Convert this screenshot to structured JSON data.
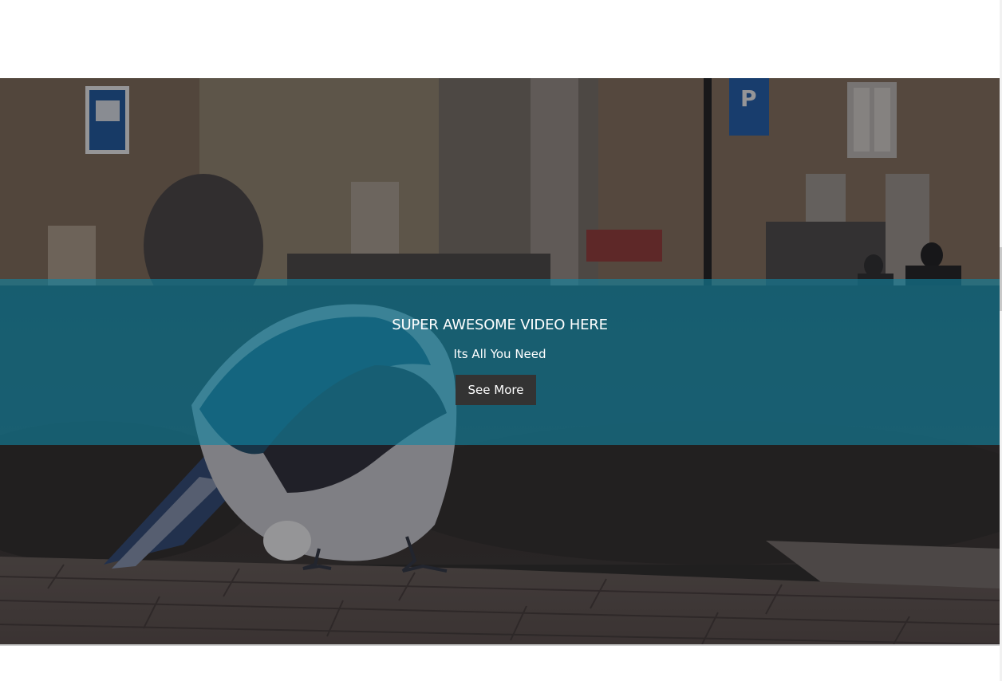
{
  "hero": {
    "headline": "SUPER AWESOME VIDEO HERE",
    "subheadline": "Its All You Need",
    "cta_label": "See More",
    "overlay_color": "#1184a2",
    "button_color": "#333333",
    "background_subject": "magpie bird on brick pavement in city square"
  }
}
